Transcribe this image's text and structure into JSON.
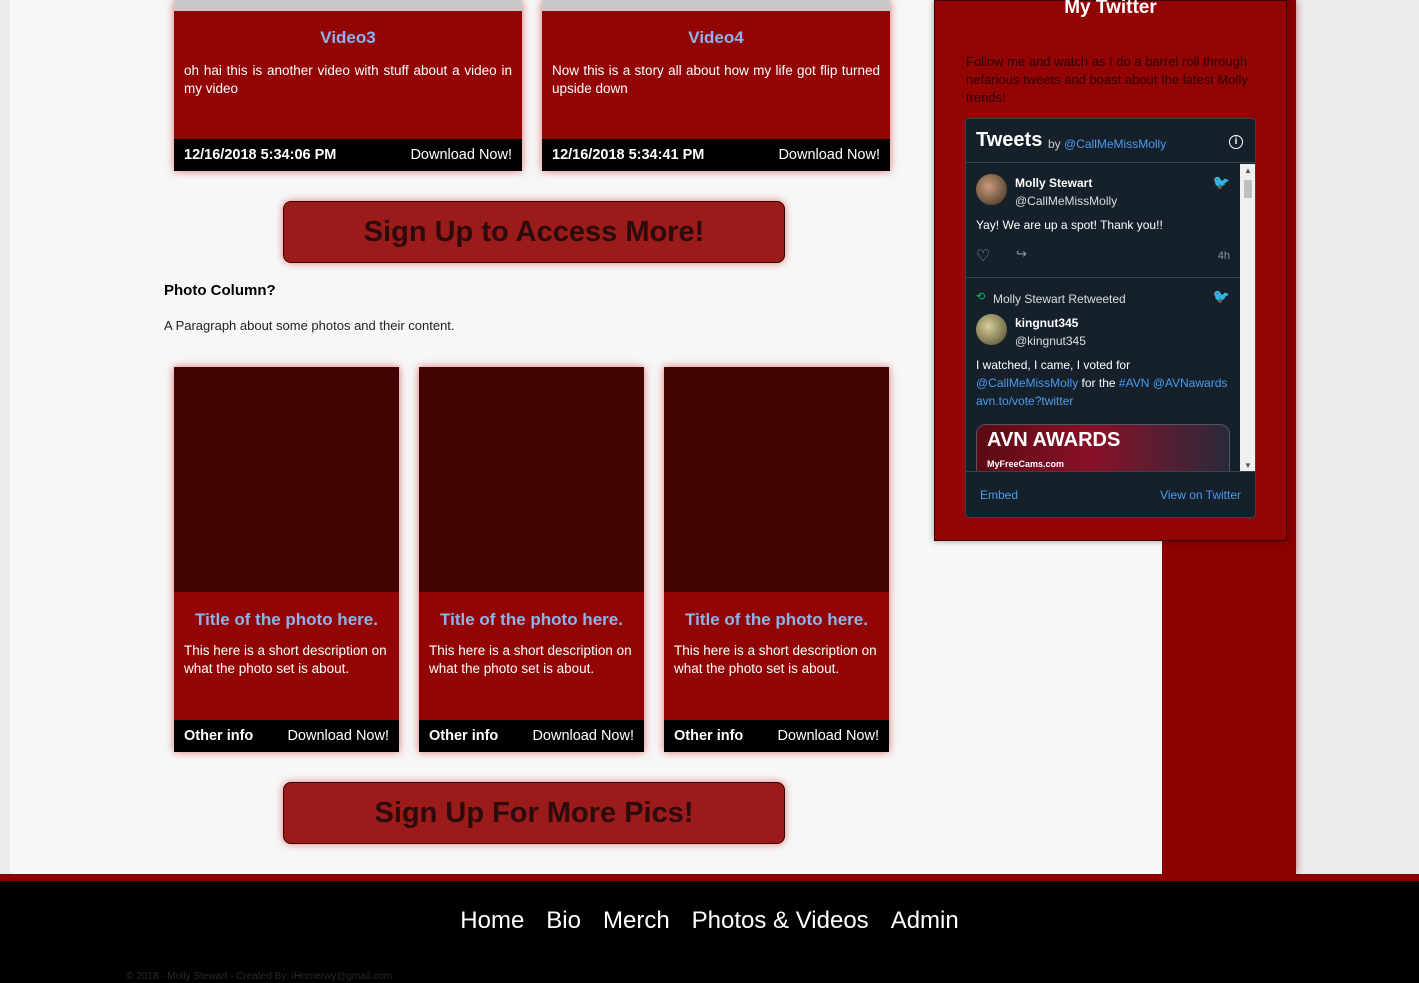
{
  "videos": [
    {
      "title": "Video3",
      "description": "oh hai this is another video with stuff about a video in my video",
      "date": "12/16/2018 5:34:06 PM",
      "download": "Download Now!"
    },
    {
      "title": "Video4",
      "description": "Now this is a story all about how my life got flip turned upside down",
      "date": "12/16/2018 5:34:41 PM",
      "download": "Download Now!"
    }
  ],
  "signup_videos": "Sign Up to Access More!",
  "photo_section": {
    "heading": "Photo Column?",
    "paragraph": "A Paragraph about some photos and their content."
  },
  "photos": [
    {
      "title": "Title of the photo here.",
      "description": "This here is a short description on what the photo set is about.",
      "info": "Other info",
      "download": "Download Now!"
    },
    {
      "title": "Title of the photo here.",
      "description": "This here is a short description on what the photo set is about.",
      "info": "Other info",
      "download": "Download Now!"
    },
    {
      "title": "Title of the photo here.",
      "description": "This here is a short description on what the photo set is about.",
      "info": "Other info",
      "download": "Download Now!"
    }
  ],
  "signup_photos": "Sign Up For More Pics!",
  "twitter": {
    "title": "My Twitter",
    "intro": "Follow me and watch as I do a barrel roll through nefarious tweets and boast about the latest Molly trends!",
    "widget": {
      "label": "Tweets",
      "by": "by",
      "handle": "@CallMeMissMolly",
      "tweet1": {
        "name": "Molly Stewart",
        "handle": "@CallMeMissMolly",
        "text": "Yay! We are up a spot! Thank you!!",
        "time": "4h"
      },
      "retweet_label": "Molly Stewart Retweeted",
      "tweet2": {
        "name": "kingnut345",
        "handle": "@kingnut345",
        "text_a": "I watched, I came, I voted for",
        "link_a": "@CallMeMissMolly",
        "text_b": "for the",
        "link_b": "#AVN",
        "link_c": "@AVNawards",
        "link_d": "avn.to/vote?twitter"
      },
      "media_text": "AVN AWARDS",
      "media_sub": "MyFreeCams.com",
      "embed": "Embed",
      "view": "View on Twitter"
    }
  },
  "footer": {
    "nav": [
      "Home",
      "Bio",
      "Merch",
      "Photos & Videos",
      "Admin"
    ],
    "copyright": "© 2018 - Molly Stewart - Created By: iHomerwy@gmail.com"
  }
}
